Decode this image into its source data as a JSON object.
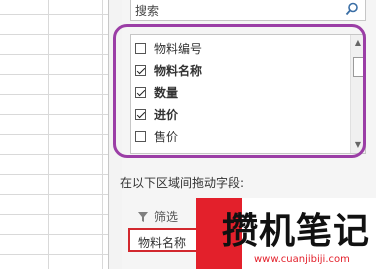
{
  "search": {
    "placeholder": "搜索"
  },
  "fields": [
    {
      "label": "物料编号",
      "checked": false,
      "bold": false
    },
    {
      "label": "物料名称",
      "checked": true,
      "bold": true
    },
    {
      "label": "数量",
      "checked": true,
      "bold": true
    },
    {
      "label": "进价",
      "checked": true,
      "bold": true
    },
    {
      "label": "售价",
      "checked": false,
      "bold": false
    }
  ],
  "areas_hint": "在以下区域间拖动字段:",
  "filter": {
    "label": "筛选",
    "items": [
      "物料名称"
    ]
  },
  "watermark": {
    "title": "攒机笔记",
    "url": "www.cuanjibiji.com"
  },
  "colors": {
    "highlight": "#9b3ea6",
    "filter_box": "#d2282e",
    "brand_red": "#e3202b"
  }
}
